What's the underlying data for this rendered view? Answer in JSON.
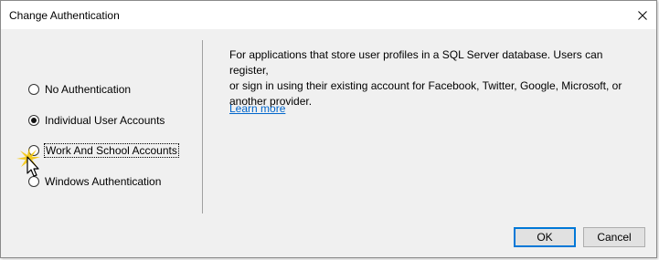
{
  "window": {
    "title": "Change Authentication",
    "close_icon": "close-icon"
  },
  "options": [
    {
      "label": "No Authentication",
      "checked": false
    },
    {
      "label": "Individual User Accounts",
      "checked": true
    },
    {
      "label": "Work And School Accounts",
      "checked": false,
      "focused": true
    },
    {
      "label": "Windows Authentication",
      "checked": false
    }
  ],
  "description": {
    "line1": "For applications that store user profiles in a SQL Server database. Users can register,",
    "line2": "or sign in using their existing account for Facebook, Twitter, Google, Microsoft, or",
    "line3": "another provider."
  },
  "learn_more": "Learn more",
  "buttons": {
    "ok": "OK",
    "cancel": "Cancel"
  },
  "colors": {
    "link": "#0066cc",
    "accent": "#0078d7",
    "cursor_highlight": "#f5c400"
  }
}
